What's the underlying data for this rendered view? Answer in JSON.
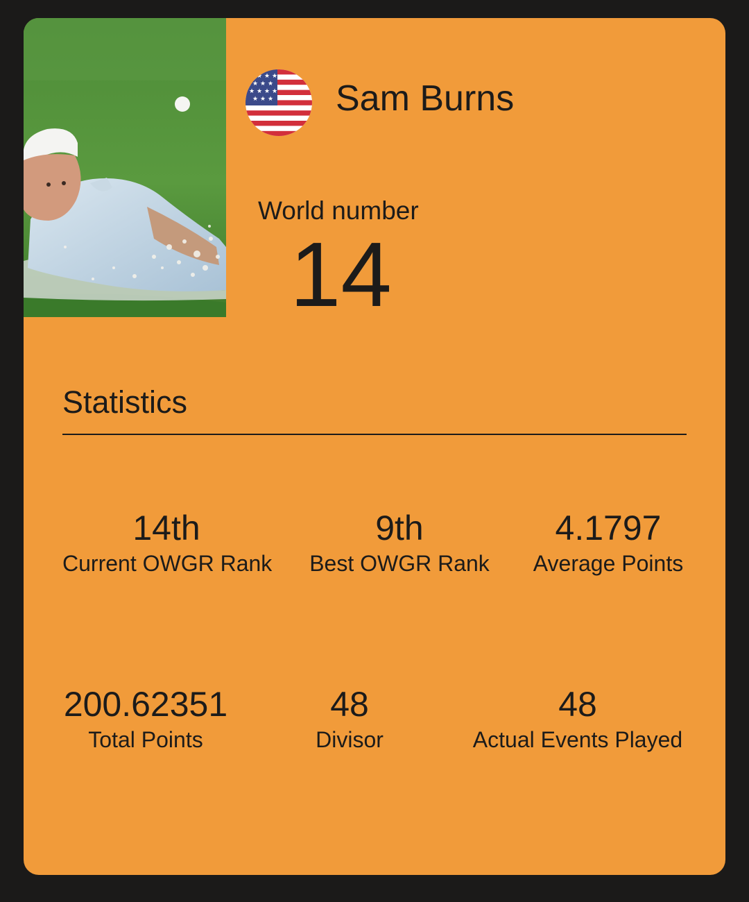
{
  "player": {
    "name": "Sam Burns",
    "country_flag_icon": "us-flag-icon",
    "photo_description": "player-photo"
  },
  "ranking": {
    "world_label": "World number",
    "world_value": "14"
  },
  "statistics": {
    "heading": "Statistics",
    "items": [
      {
        "value": "14th",
        "label": "Current OWGR Rank"
      },
      {
        "value": "9th",
        "label": "Best OWGR Rank"
      },
      {
        "value": "4.1797",
        "label": "Average Points"
      },
      {
        "value": "200.62351",
        "label": "Total Points"
      },
      {
        "value": "48",
        "label": "Divisor"
      },
      {
        "value": "48",
        "label": "Actual Events Played"
      }
    ]
  },
  "colors": {
    "background": "#1b1a19",
    "card": "#f19b3a",
    "text": "#1c1b1a"
  }
}
